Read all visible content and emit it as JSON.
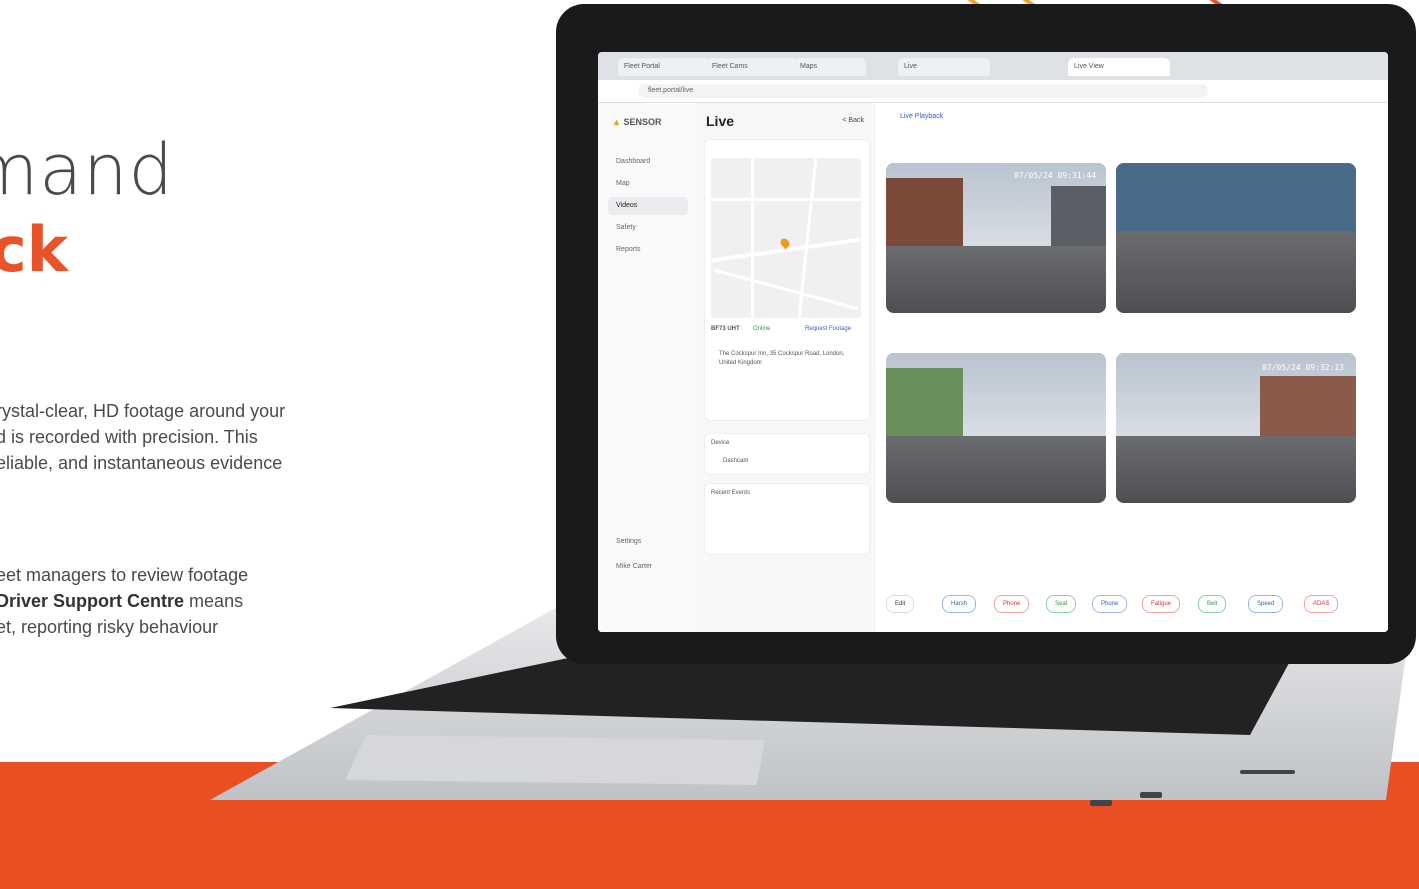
{
  "headline": {
    "line1": "mand",
    "line2": "ck"
  },
  "paragraph1": [
    "rystal-clear, HD footage around your",
    "d is recorded with precision. This",
    "eliable, and instantaneous evidence",
    "."
  ],
  "paragraph2": {
    "line1": "eet managers to review footage",
    "bold": "Driver Support Centre",
    "line2_tail": " means",
    "line3": "et, reporting risky behaviour"
  },
  "colors": {
    "accent": "#ea4f24",
    "headline_text": "#4a4a4a"
  },
  "browser": {
    "tabs": [
      "Fleet Portal",
      "Fleet Cams",
      "Maps",
      "Live",
      "Live View"
    ],
    "url": "fleet.portal/live"
  },
  "app": {
    "logo": "SENSOR",
    "nav": [
      "Dashboard",
      "Map",
      "Videos",
      "Safety",
      "Reports",
      "Settings"
    ],
    "nav_selected_index": 2,
    "user": "Mike Carter",
    "panel_title": "Live",
    "back_label": "< Back",
    "vehicle_reg": "BF73 UHT",
    "status": "Online",
    "request_label": "Request Footage",
    "address": "The Cockspur Inn, 35 Cockspur Road, London, United Kingdom",
    "section_device": "Device",
    "device_name": "Dashcam",
    "section_recent": "Recent Events",
    "main_header": "Live Playback",
    "cam_times": [
      "07/05/24 09:31:44",
      "",
      "",
      "07/05/24 09:32:13"
    ],
    "buttons": [
      "Edit",
      "Harsh",
      "Phone",
      "Seat",
      "Phone",
      "Fatigue",
      "Belt",
      "Speed",
      "ADAS"
    ]
  }
}
